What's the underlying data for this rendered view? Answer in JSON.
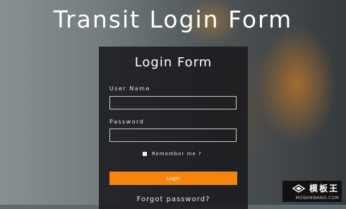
{
  "page": {
    "title": "Transit Login Form"
  },
  "form": {
    "title": "Login Form",
    "user_label": "User Name",
    "user_value": "",
    "user_placeholder": "",
    "password_label": "Password",
    "password_value": "",
    "password_placeholder": "",
    "remember_label": "Remember me ?",
    "remember_checked": false,
    "login_label": "Login",
    "forgot_label": "Forgot password?"
  },
  "watermark": {
    "name": "模板王",
    "url": "MOBANWANG.COM"
  },
  "colors": {
    "accent": "#f6850d",
    "panel": "#18181c"
  }
}
